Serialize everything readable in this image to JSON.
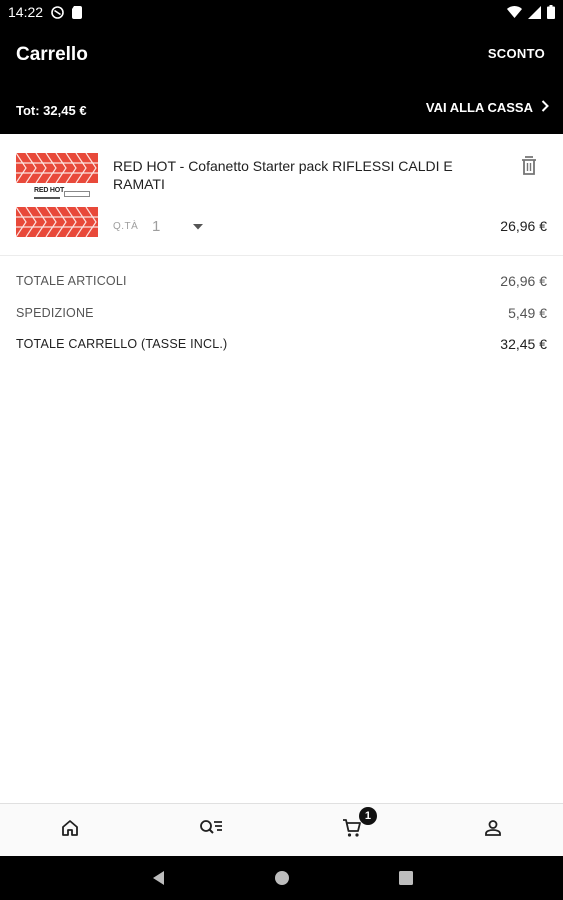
{
  "status_bar": {
    "time": "14:22",
    "icons": [
      "vpn-icon",
      "sim-card-icon",
      "wifi-icon",
      "signal-icon",
      "battery-icon"
    ]
  },
  "header": {
    "title": "Carrello",
    "discount_label": "SCONTO",
    "total_label": "Tot: 32,45 €",
    "checkout_label": "VAI ALLA CASSA"
  },
  "cart": {
    "items": [
      {
        "thumbnail": {
          "brand": "RED HOT",
          "accent_color": "#e8493a"
        },
        "name": "RED HOT - Cofanetto Starter pack RIFLESSI CALDI E RAMATI",
        "qty_label": "Q.TÀ",
        "qty_value": "1",
        "price": "26,96 €"
      }
    ]
  },
  "summary": {
    "rows": [
      {
        "label": "TOTALE ARTICOLI",
        "value": "26,96 €"
      },
      {
        "label": "SPEDIZIONE",
        "value": "5,49 €"
      },
      {
        "label": "TOTALE CARRELLO (TASSE INCL.)",
        "value": "32,45 €"
      }
    ]
  },
  "bottom_nav": {
    "tabs": [
      "home-icon",
      "search-filter-icon",
      "cart-icon",
      "account-icon"
    ],
    "cart_badge": "1"
  },
  "colors": {
    "header_bg": "#000000",
    "accent_red": "#e8493a",
    "text_primary": "#212121",
    "text_secondary": "#9e9e9e"
  }
}
